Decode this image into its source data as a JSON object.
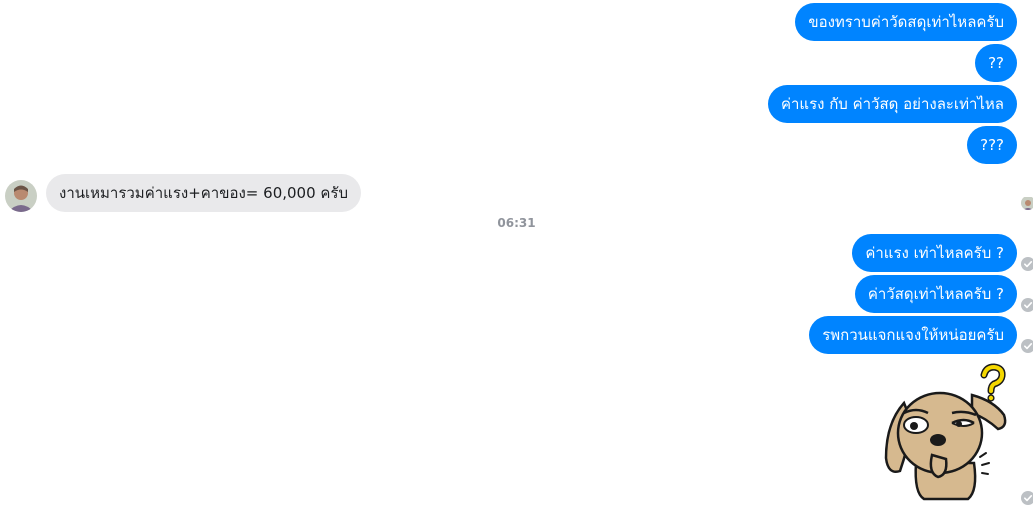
{
  "messages_outgoing_top": [
    {
      "text": "ของทราบค่าวัดสดุเท่าไหลครับ"
    },
    {
      "text": "??"
    },
    {
      "text": "ค่าแรง กับ ค่าวัสดุ อย่างละเท่าไหล"
    },
    {
      "text": "???"
    }
  ],
  "message_incoming": {
    "text": "งานเหมารวมค่าแรง+คาของ= 60,000  ครับ"
  },
  "timestamp": "06:31",
  "messages_outgoing_bottom": [
    {
      "text": "ค่าแรง เท่าไหลครับ ?"
    },
    {
      "text": "ค่าวัสดุเท่าไหลครับ ?"
    },
    {
      "text": "รพกวนแจกแจงให้หน่อยครับ"
    }
  ],
  "sticker": {
    "icon": "confused-dog-sticker-icon"
  },
  "colors": {
    "outgoing_bubble": "#0084ff",
    "incoming_bubble": "#e9e9eb",
    "timestamp": "#90949c",
    "check": "#bcc0c4"
  }
}
